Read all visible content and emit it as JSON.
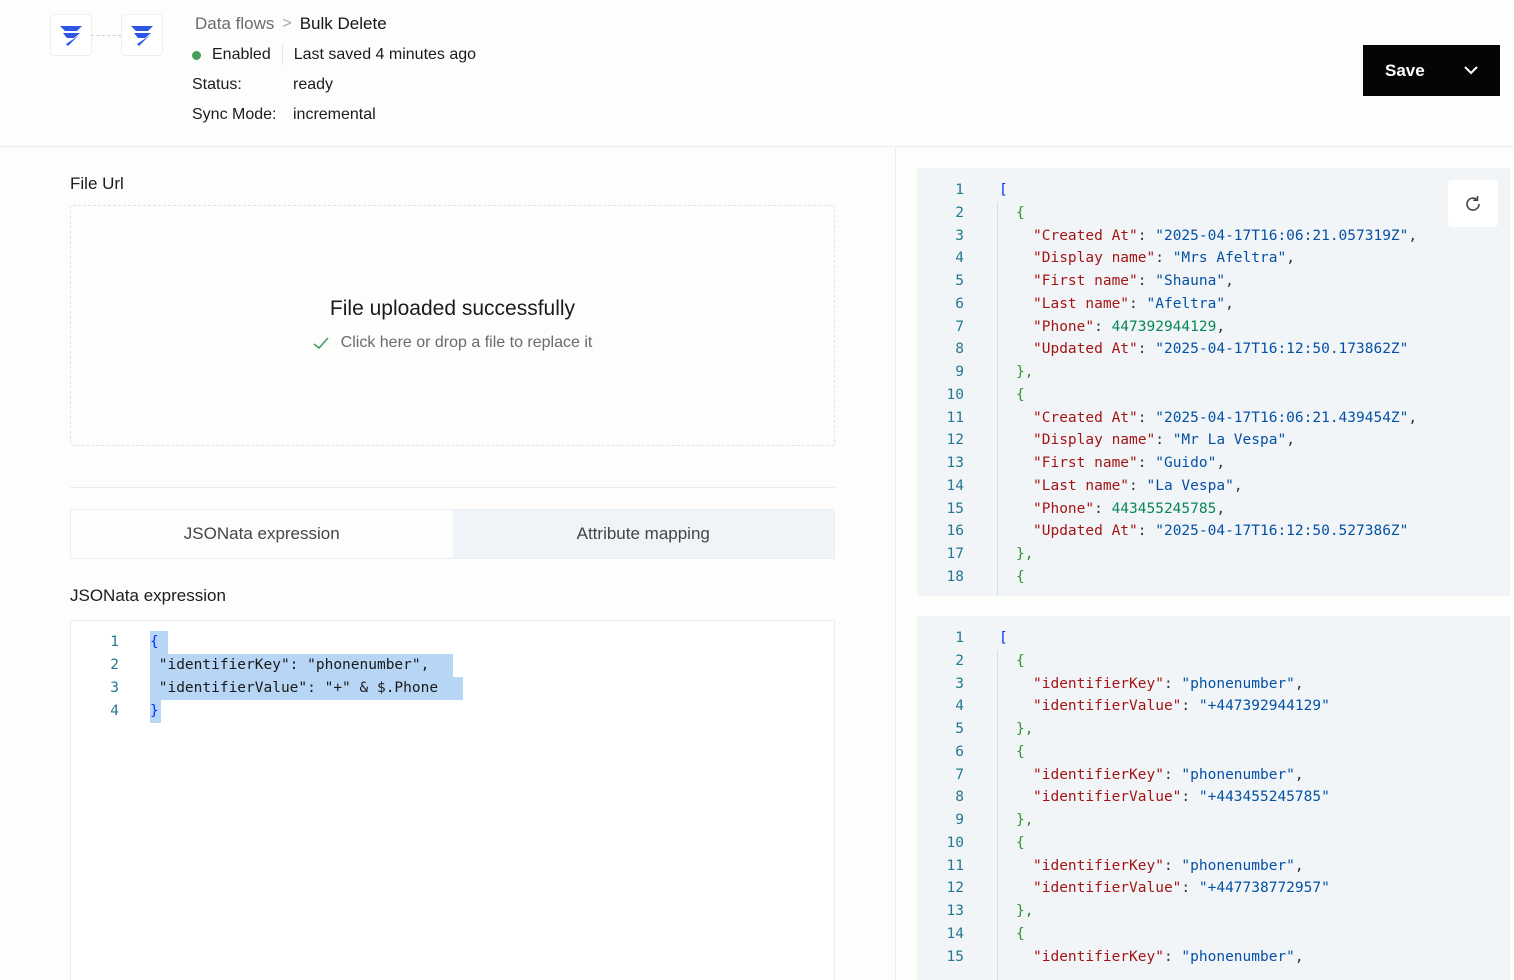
{
  "header": {
    "breadcrumb": {
      "parent": "Data flows",
      "separator": ">",
      "current": "Bulk Delete"
    },
    "enabled_label": "Enabled",
    "last_saved": "Last saved 4 minutes ago",
    "status": {
      "label": "Status:",
      "value": "ready"
    },
    "sync_mode": {
      "label": "Sync Mode:",
      "value": "incremental"
    },
    "save_button": "Save",
    "logo_icon": "brand-logo-icon",
    "colors": {
      "enabled_dot": "#4a9d5f",
      "save_bg": "#050505"
    }
  },
  "file_url": {
    "label": "File Url",
    "upload_title": "File uploaded successfully",
    "upload_hint": "Click here or drop a file to replace it"
  },
  "tabs": [
    {
      "label": "JSONata expression",
      "active": true
    },
    {
      "label": "Attribute mapping",
      "active": false
    }
  ],
  "expression": {
    "label": "JSONata expression",
    "lines": [
      {
        "num": "1",
        "text": "{"
      },
      {
        "num": "2",
        "text": " \"identifierKey\": \"phonenumber\","
      },
      {
        "num": "3",
        "text": " \"identifierValue\": \"+\" & $.Phone"
      },
      {
        "num": "4",
        "text": "}"
      }
    ]
  },
  "input_preview": {
    "lines": [
      {
        "num": "1",
        "text": "["
      },
      {
        "num": "2",
        "text": "{"
      },
      {
        "num": "3",
        "key": "\"Created At\"",
        "value": "\"2025-04-17T16:06:21.057319Z\"",
        "comma": ","
      },
      {
        "num": "4",
        "key": "\"Display name\"",
        "value": "\"Mrs Afeltra\"",
        "comma": ","
      },
      {
        "num": "5",
        "key": "\"First name\"",
        "value": "\"Shauna\"",
        "comma": ","
      },
      {
        "num": "6",
        "key": "\"Last name\"",
        "value": "\"Afeltra\"",
        "comma": ","
      },
      {
        "num": "7",
        "key": "\"Phone\"",
        "number": "447392944129",
        "comma": ","
      },
      {
        "num": "8",
        "key": "\"Updated At\"",
        "value": "\"2025-04-17T16:12:50.173862Z\"",
        "comma": ""
      },
      {
        "num": "9",
        "text": "},"
      },
      {
        "num": "10",
        "text": "{"
      },
      {
        "num": "11",
        "key": "\"Created At\"",
        "value": "\"2025-04-17T16:06:21.439454Z\"",
        "comma": ","
      },
      {
        "num": "12",
        "key": "\"Display name\"",
        "value": "\"Mr La Vespa\"",
        "comma": ","
      },
      {
        "num": "13",
        "key": "\"First name\"",
        "value": "\"Guido\"",
        "comma": ","
      },
      {
        "num": "14",
        "key": "\"Last name\"",
        "value": "\"La Vespa\"",
        "comma": ","
      },
      {
        "num": "15",
        "key": "\"Phone\"",
        "number": "443455245785",
        "comma": ","
      },
      {
        "num": "16",
        "key": "\"Updated At\"",
        "value": "\"2025-04-17T16:12:50.527386Z\"",
        "comma": ""
      },
      {
        "num": "17",
        "text": "},"
      },
      {
        "num": "18",
        "text": "{"
      }
    ],
    "refresh_icon": "refresh-icon"
  },
  "output_preview": {
    "lines": [
      {
        "num": "1",
        "text": "["
      },
      {
        "num": "2",
        "text": "{"
      },
      {
        "num": "3",
        "key": "\"identifierKey\"",
        "value": "\"phonenumber\"",
        "comma": ","
      },
      {
        "num": "4",
        "key": "\"identifierValue\"",
        "value": "\"+447392944129\"",
        "comma": ""
      },
      {
        "num": "5",
        "text": "},"
      },
      {
        "num": "6",
        "text": "{"
      },
      {
        "num": "7",
        "key": "\"identifierKey\"",
        "value": "\"phonenumber\"",
        "comma": ","
      },
      {
        "num": "8",
        "key": "\"identifierValue\"",
        "value": "\"+443455245785\"",
        "comma": ""
      },
      {
        "num": "9",
        "text": "},"
      },
      {
        "num": "10",
        "text": "{"
      },
      {
        "num": "11",
        "key": "\"identifierKey\"",
        "value": "\"phonenumber\"",
        "comma": ","
      },
      {
        "num": "12",
        "key": "\"identifierValue\"",
        "value": "\"+447738772957\"",
        "comma": ""
      },
      {
        "num": "13",
        "text": "},"
      },
      {
        "num": "14",
        "text": "{"
      },
      {
        "num": "15",
        "key": "\"identifierKey\"",
        "value": "\"phonenumber\"",
        "comma": ","
      }
    ]
  }
}
